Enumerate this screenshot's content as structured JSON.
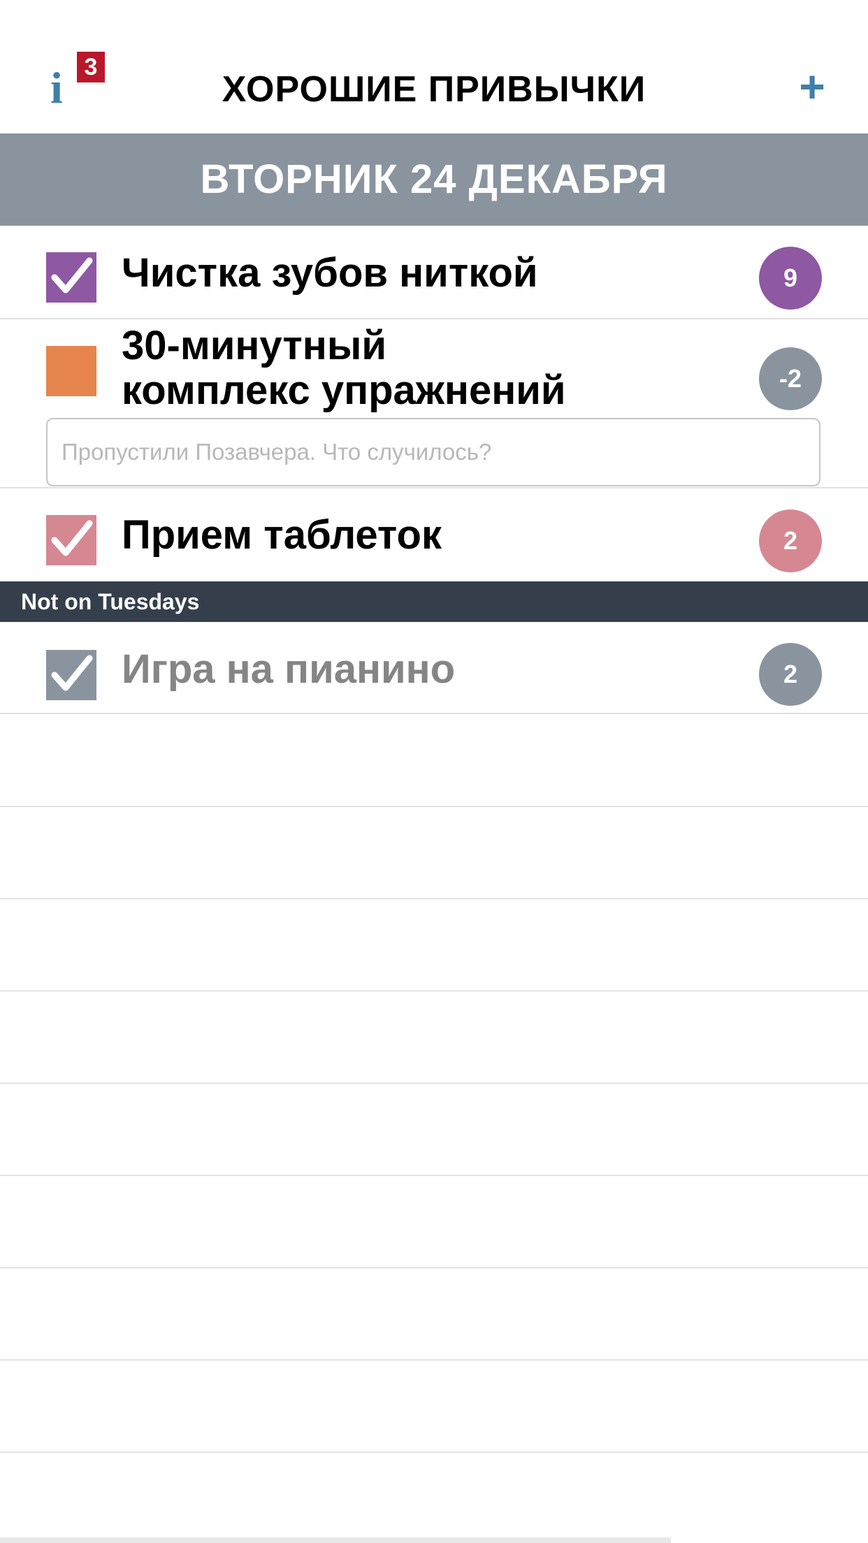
{
  "header": {
    "info_icon": "i",
    "info_badge": "3",
    "title": "ХОРОШИЕ ПРИВЫЧКИ",
    "add_icon": "+"
  },
  "date_bar": {
    "label": "ВТОРНИК 24 ДЕКАБРЯ"
  },
  "habits": [
    {
      "name": "Чистка зубов ниткой",
      "checked": true,
      "color": "#8e58a3",
      "count": "9"
    },
    {
      "name_line1": "30-минутный",
      "name_line2": "комплекс упражнений",
      "checked": false,
      "color": "#e5854d",
      "count": "-2",
      "count_color": "#8a949f",
      "note_placeholder": "Пропустили Позавчера. Что случилось?"
    },
    {
      "name": "Прием таблеток",
      "checked": true,
      "color": "#d58892",
      "count": "2"
    }
  ],
  "section": {
    "label": "Not on Tuesdays",
    "habits": [
      {
        "name": "Игра на пианино",
        "checked": true,
        "color": "#8a949f",
        "count": "2"
      }
    ]
  },
  "colors": {
    "accent": "#3f7fa8",
    "badge": "#b8182a",
    "date_bar": "#8a949f",
    "section_bar": "#353f4c",
    "muted_text": "#858585"
  }
}
